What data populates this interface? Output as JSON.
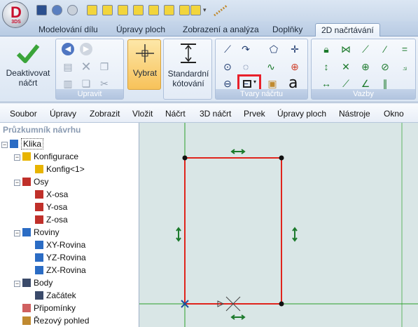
{
  "app": {
    "logo_letter": "D",
    "logo_sub": "3DS"
  },
  "ribbon_tabs": [
    "Modelování dílu",
    "Úpravy ploch",
    "Zobrazení a analýza",
    "Doplňky",
    "2D načrtávání"
  ],
  "active_tab": "2D načrtávání",
  "ribbon": {
    "exit_sketch_label": "Deaktivovat náčrt",
    "edit_group_label": "Upravit",
    "select_label": "Vybrat",
    "dimension_label": "Standardní kótování",
    "shapes_group_label": "Tvary náčrtu",
    "constraints_group_label": "Vazby",
    "text_tool_glyph": "a"
  },
  "menu": [
    "Soubor",
    "Úpravy",
    "Zobrazit",
    "Vložit",
    "Náčrt",
    "3D náčrt",
    "Prvek",
    "Úpravy ploch",
    "Nástroje",
    "Okno"
  ],
  "tree": {
    "title": "Průzkumník návrhu",
    "nodes": [
      {
        "label": "Klika",
        "level": 0,
        "expander": "−"
      },
      {
        "label": "Konfigurace",
        "level": 1,
        "expander": "−"
      },
      {
        "label": "Konfig<1>",
        "level": 2,
        "expander": ""
      },
      {
        "label": "Osy",
        "level": 1,
        "expander": "−"
      },
      {
        "label": "X-osa",
        "level": 2,
        "expander": ""
      },
      {
        "label": "Y-osa",
        "level": 2,
        "expander": ""
      },
      {
        "label": "Z-osa",
        "level": 2,
        "expander": ""
      },
      {
        "label": "Roviny",
        "level": 1,
        "expander": "−"
      },
      {
        "label": "XY-Rovina",
        "level": 2,
        "expander": ""
      },
      {
        "label": "YZ-Rovina",
        "level": 2,
        "expander": ""
      },
      {
        "label": "ZX-Rovina",
        "level": 2,
        "expander": ""
      },
      {
        "label": "Body",
        "level": 1,
        "expander": "−"
      },
      {
        "label": "Začátek",
        "level": 2,
        "expander": ""
      },
      {
        "label": "Připomínky",
        "level": 1,
        "expander": ""
      },
      {
        "label": "Řezový pohled",
        "level": 1,
        "expander": ""
      }
    ]
  },
  "colors": {
    "sketch_line": "#e0241c",
    "highlight": "#e8202a",
    "constraint": "#1c7a2c",
    "axis": "#2aa02a",
    "canvas": "#d9e6e6"
  }
}
